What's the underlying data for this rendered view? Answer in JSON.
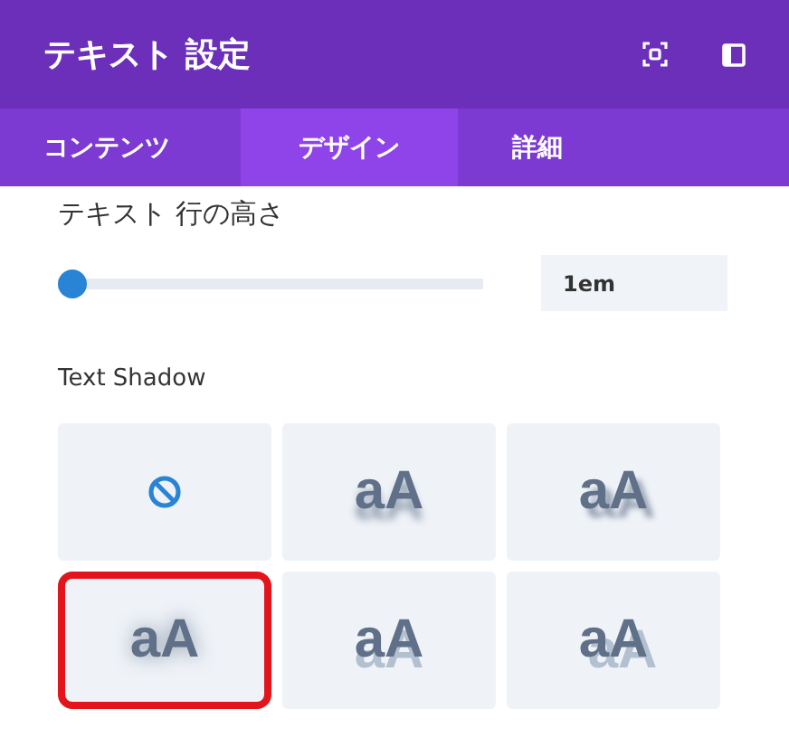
{
  "window": {
    "title": "テキスト 設定"
  },
  "tabs": [
    {
      "label": "コンテンツ",
      "selected": false
    },
    {
      "label": "デザイン",
      "selected": true
    },
    {
      "label": "詳細",
      "selected": false
    }
  ],
  "line_height": {
    "label": "テキスト 行の高さ",
    "level": 0.0,
    "value": "1em"
  },
  "text_shadow": {
    "label": "Text Shadow",
    "options": [
      {
        "kind": "none",
        "selected": false
      },
      {
        "kind": "bottom",
        "text": "aA",
        "selected": false
      },
      {
        "kind": "bottom-right",
        "text": "aA",
        "selected": false
      },
      {
        "kind": "glow",
        "text": "aA",
        "selected": true
      },
      {
        "kind": "hard-bottom",
        "text": "aA",
        "selected": false
      },
      {
        "kind": "hard-bottom-right",
        "text": "aA",
        "selected": false
      }
    ]
  }
}
